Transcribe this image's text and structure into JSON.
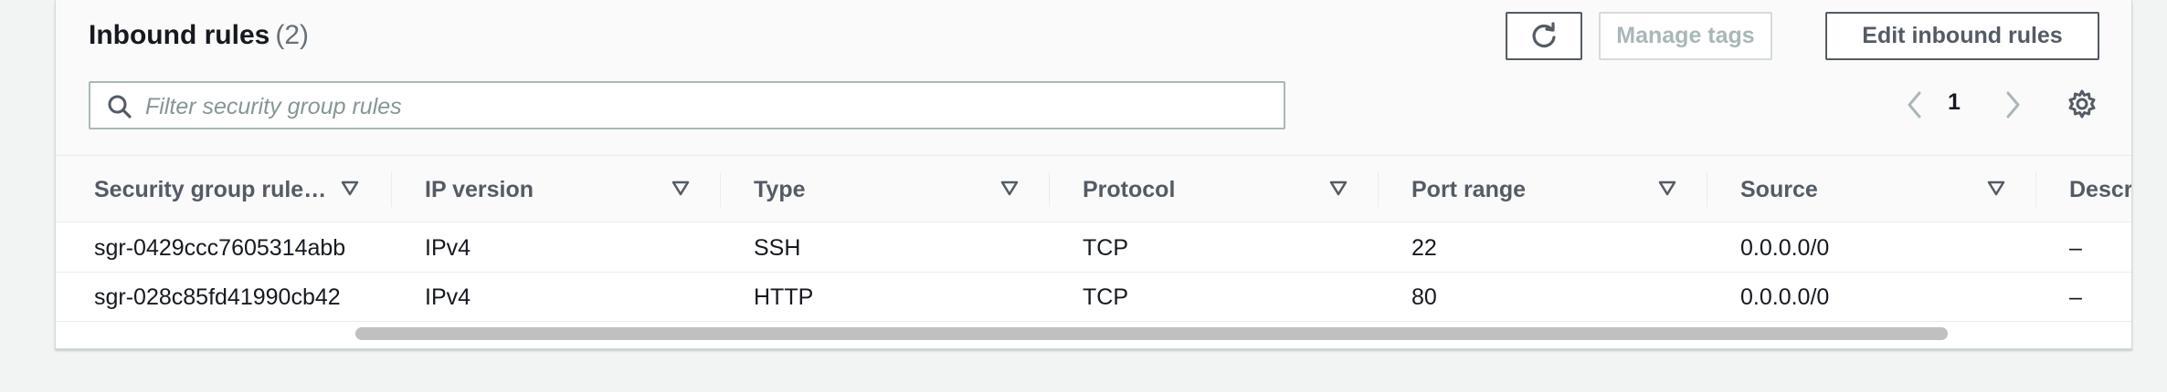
{
  "section": {
    "title": "Inbound rules",
    "count": "(2)"
  },
  "toolbar": {
    "refresh_icon": "refresh-icon",
    "manage_tags_label": "Manage tags",
    "edit_label": "Edit inbound rules"
  },
  "search": {
    "placeholder": "Filter security group rules",
    "icon": "search-icon"
  },
  "pagination": {
    "current_page": "1",
    "prev_icon": "chevron-left-icon",
    "next_icon": "chevron-right-icon",
    "settings_icon": "gear-icon"
  },
  "table": {
    "columns": [
      "Security group rule…",
      "IP version",
      "Type",
      "Protocol",
      "Port range",
      "Source",
      "Descri"
    ],
    "rows": [
      [
        "sgr-0429ccc7605314abb",
        "IPv4",
        "SSH",
        "TCP",
        "22",
        "0.0.0.0/0",
        "–"
      ],
      [
        "sgr-028c85fd41990cb42",
        "IPv4",
        "HTTP",
        "TCP",
        "80",
        "0.0.0.0/0",
        "–"
      ]
    ]
  },
  "colors": {
    "text": "#16191f",
    "muted": "#545b64",
    "disabled": "#aab7b8",
    "border": "#eaeded",
    "background": "#f2f3f3"
  }
}
